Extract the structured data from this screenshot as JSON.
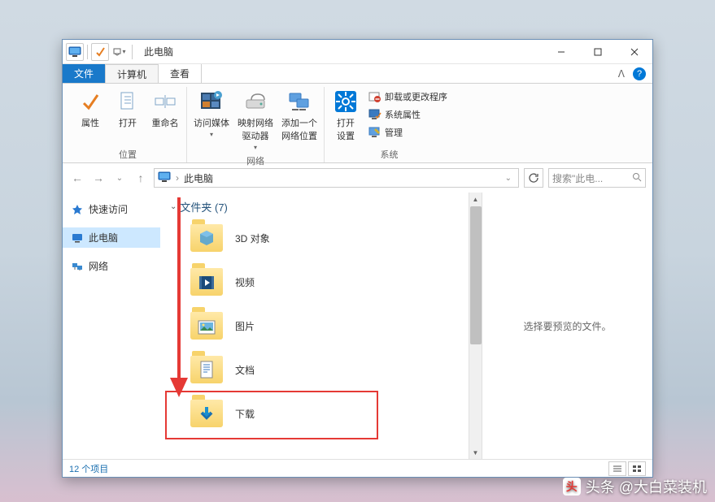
{
  "titlebar": {
    "title": "此电脑"
  },
  "tabs": {
    "file": "文件",
    "computer": "计算机",
    "view": "查看"
  },
  "ribbon": {
    "group1": {
      "label": "位置",
      "props": "属性",
      "open": "打开",
      "rename": "重命名"
    },
    "group2": {
      "label": "网络",
      "media": "访问媒体",
      "map": "映射网络\n驱动器",
      "addloc": "添加一个\n网络位置"
    },
    "group3": {
      "label": "系统",
      "settings": "打开\n设置",
      "uninstall": "卸载或更改程序",
      "sysprops": "系统属性",
      "manage": "管理"
    }
  },
  "nav": {
    "back": "←",
    "forward": "→",
    "up": "↑"
  },
  "address": {
    "crumb": "此电脑"
  },
  "search": {
    "placeholder": "搜索\"此电..."
  },
  "sidebar": {
    "items": [
      {
        "label": "快速访问"
      },
      {
        "label": "此电脑"
      },
      {
        "label": "网络"
      }
    ]
  },
  "content": {
    "group_label": "文件夹 (7)",
    "items": [
      {
        "label": "3D 对象"
      },
      {
        "label": "视频"
      },
      {
        "label": "图片"
      },
      {
        "label": "文档"
      },
      {
        "label": "下载"
      }
    ]
  },
  "preview": {
    "text": "选择要预览的文件。"
  },
  "status": {
    "count": "12 个项目"
  },
  "watermark": {
    "text": "头条 @大白菜装机"
  }
}
